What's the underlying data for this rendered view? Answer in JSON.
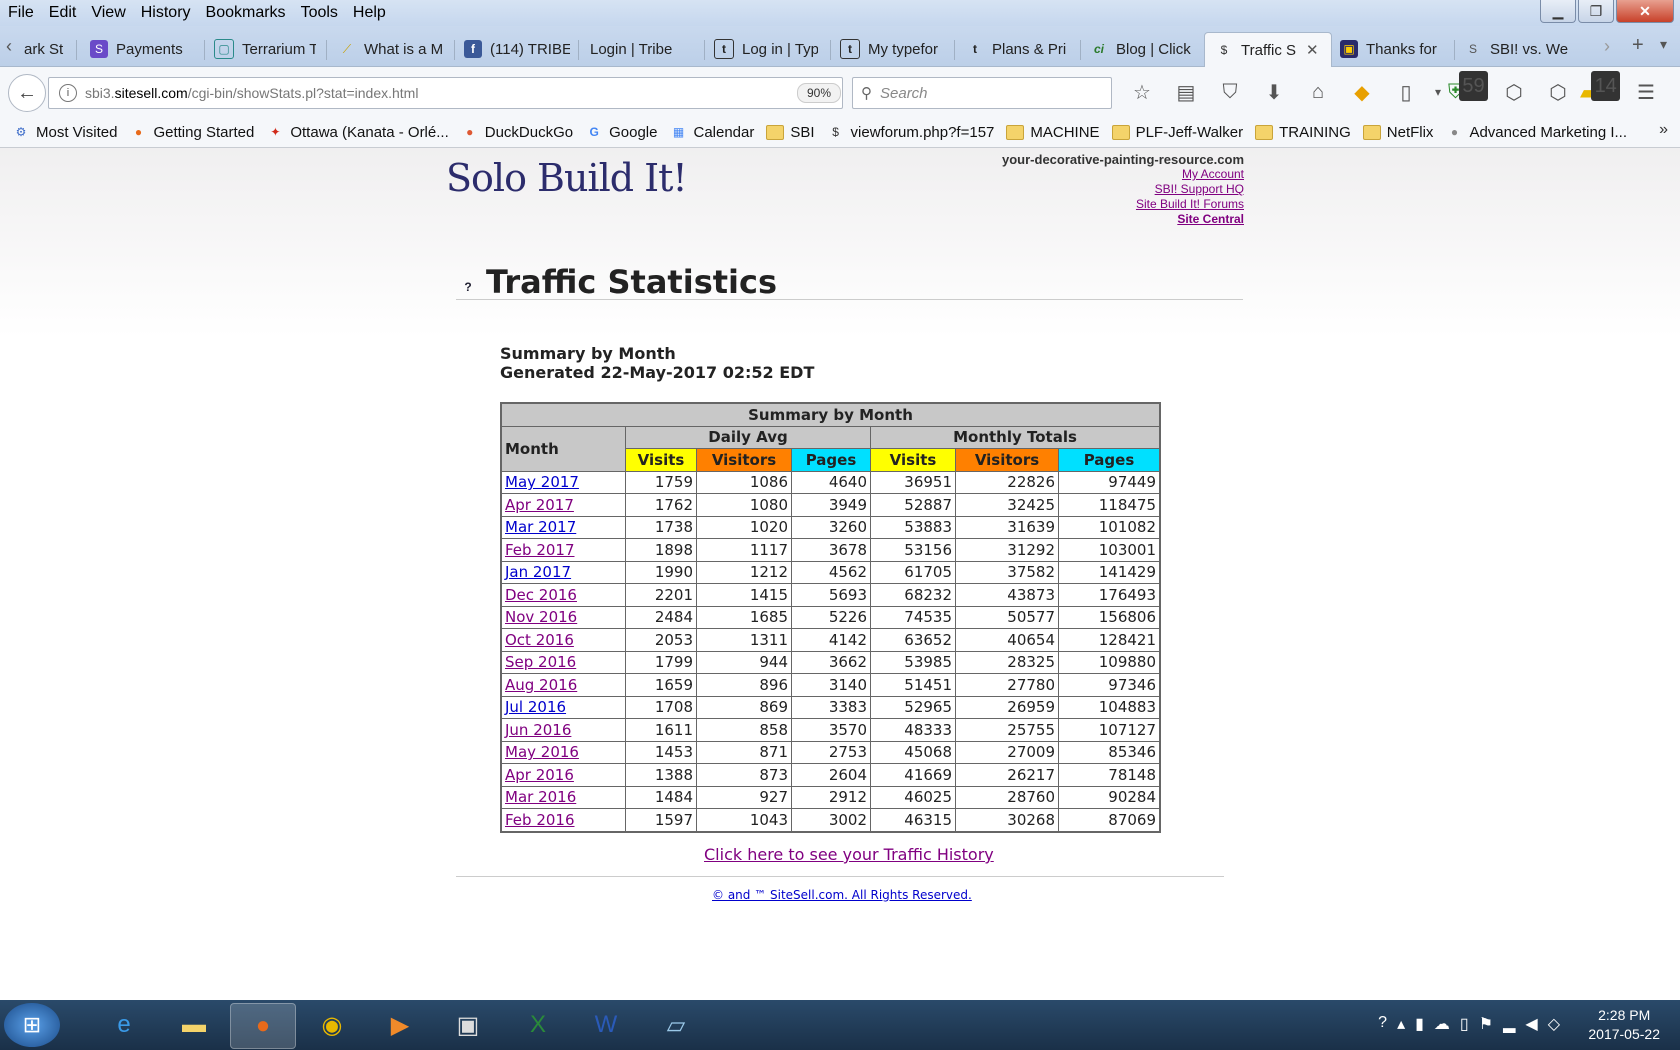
{
  "menubar": [
    "File",
    "Edit",
    "View",
    "History",
    "Bookmarks",
    "Tools",
    "Help"
  ],
  "tabs": [
    {
      "label": "ark St",
      "icon": ""
    },
    {
      "label": "Payments",
      "icon": "S"
    },
    {
      "label": "Terrarium T",
      "icon": "▢"
    },
    {
      "label": "What is a M",
      "icon": "⟋"
    },
    {
      "label": "(114) TRIBE",
      "icon": "f"
    },
    {
      "label": "Login | Tribe",
      "icon": ""
    },
    {
      "label": "Log in | Typ",
      "icon": "t"
    },
    {
      "label": "My typefor",
      "icon": "t"
    },
    {
      "label": "Plans & Pri",
      "icon": "t"
    },
    {
      "label": "Blog | Click",
      "icon": "ci"
    },
    {
      "label": "Traffic S",
      "icon": "$",
      "active": true
    },
    {
      "label": "Thanks for",
      "icon": "▣"
    },
    {
      "label": "SBI! vs. We",
      "icon": "S"
    }
  ],
  "nav": {
    "url_prefix": "sbi3.",
    "url_domain": "sitesell.com",
    "url_path": "/cgi-bin/showStats.pl?stat=index.html",
    "zoom": "90%",
    "search_placeholder": "Search",
    "badge1": "59",
    "badge2": "14"
  },
  "bookmarks": [
    {
      "label": "Most Visited",
      "icon": "⚙"
    },
    {
      "label": "Getting Started",
      "icon": "●"
    },
    {
      "label": "Ottawa (Kanata - Orlé...",
      "icon": "✦"
    },
    {
      "label": "DuckDuckGo",
      "icon": "●"
    },
    {
      "label": "Google",
      "icon": "G"
    },
    {
      "label": "Calendar",
      "icon": "▦"
    },
    {
      "label": "SBI",
      "icon": "folder"
    },
    {
      "label": "viewforum.php?f=157",
      "icon": "$"
    },
    {
      "label": "MACHINE",
      "icon": "folder"
    },
    {
      "label": "PLF-Jeff-Walker",
      "icon": "folder"
    },
    {
      "label": "TRAINING",
      "icon": "folder"
    },
    {
      "label": "NetFlix",
      "icon": "folder"
    },
    {
      "label": "Advanced Marketing I...",
      "icon": "●"
    }
  ],
  "site": {
    "logo": "Solo Build It!",
    "domain": "your-decorative-painting-resource.com",
    "links": [
      "My Account",
      "SBI! Support HQ",
      "Site Build It! Forums",
      "Site Central"
    ],
    "page_title": "Traffic Statistics",
    "summary_title": "Summary by Month",
    "generated": "Generated 22-May-2017 02:52 EDT",
    "table_title": "Summary by Month",
    "col_month": "Month",
    "group_daily": "Daily Avg",
    "group_monthly": "Monthly Totals",
    "col_visits": "Visits",
    "col_visitors": "Visitors",
    "col_pages": "Pages",
    "history_link": "Click here to see your Traffic History",
    "copyright": "© and ™ SiteSell.com.  All Rights Reserved."
  },
  "rows": [
    {
      "month": "May 2017",
      "d_visits": "1759",
      "d_visitors": "1086",
      "d_pages": "4640",
      "m_visits": "36951",
      "m_visitors": "22826",
      "m_pages": "97449"
    },
    {
      "month": "Apr 2017",
      "d_visits": "1762",
      "d_visitors": "1080",
      "d_pages": "3949",
      "m_visits": "52887",
      "m_visitors": "32425",
      "m_pages": "118475"
    },
    {
      "month": "Mar 2017",
      "d_visits": "1738",
      "d_visitors": "1020",
      "d_pages": "3260",
      "m_visits": "53883",
      "m_visitors": "31639",
      "m_pages": "101082"
    },
    {
      "month": "Feb 2017",
      "d_visits": "1898",
      "d_visitors": "1117",
      "d_pages": "3678",
      "m_visits": "53156",
      "m_visitors": "31292",
      "m_pages": "103001"
    },
    {
      "month": "Jan 2017",
      "d_visits": "1990",
      "d_visitors": "1212",
      "d_pages": "4562",
      "m_visits": "61705",
      "m_visitors": "37582",
      "m_pages": "141429"
    },
    {
      "month": "Dec 2016",
      "d_visits": "2201",
      "d_visitors": "1415",
      "d_pages": "5693",
      "m_visits": "68232",
      "m_visitors": "43873",
      "m_pages": "176493"
    },
    {
      "month": "Nov 2016",
      "d_visits": "2484",
      "d_visitors": "1685",
      "d_pages": "5226",
      "m_visits": "74535",
      "m_visitors": "50577",
      "m_pages": "156806"
    },
    {
      "month": "Oct 2016",
      "d_visits": "2053",
      "d_visitors": "1311",
      "d_pages": "4142",
      "m_visits": "63652",
      "m_visitors": "40654",
      "m_pages": "128421"
    },
    {
      "month": "Sep 2016",
      "d_visits": "1799",
      "d_visitors": "944",
      "d_pages": "3662",
      "m_visits": "53985",
      "m_visitors": "28325",
      "m_pages": "109880"
    },
    {
      "month": "Aug 2016",
      "d_visits": "1659",
      "d_visitors": "896",
      "d_pages": "3140",
      "m_visits": "51451",
      "m_visitors": "27780",
      "m_pages": "97346"
    },
    {
      "month": "Jul 2016",
      "d_visits": "1708",
      "d_visitors": "869",
      "d_pages": "3383",
      "m_visits": "52965",
      "m_visitors": "26959",
      "m_pages": "104883"
    },
    {
      "month": "Jun 2016",
      "d_visits": "1611",
      "d_visitors": "858",
      "d_pages": "3570",
      "m_visits": "48333",
      "m_visitors": "25755",
      "m_pages": "107127"
    },
    {
      "month": "May 2016",
      "d_visits": "1453",
      "d_visitors": "871",
      "d_pages": "2753",
      "m_visits": "45068",
      "m_visitors": "27009",
      "m_pages": "85346"
    },
    {
      "month": "Apr 2016",
      "d_visits": "1388",
      "d_visitors": "873",
      "d_pages": "2604",
      "m_visits": "41669",
      "m_visitors": "26217",
      "m_pages": "78148"
    },
    {
      "month": "Mar 2016",
      "d_visits": "1484",
      "d_visitors": "927",
      "d_pages": "2912",
      "m_visits": "46025",
      "m_visitors": "28760",
      "m_pages": "90284"
    },
    {
      "month": "Feb 2016",
      "d_visits": "1597",
      "d_visitors": "1043",
      "d_pages": "3002",
      "m_visits": "46315",
      "m_visitors": "30268",
      "m_pages": "87069"
    }
  ],
  "taskbar": {
    "time": "2:28 PM",
    "date": "2017-05-22"
  }
}
